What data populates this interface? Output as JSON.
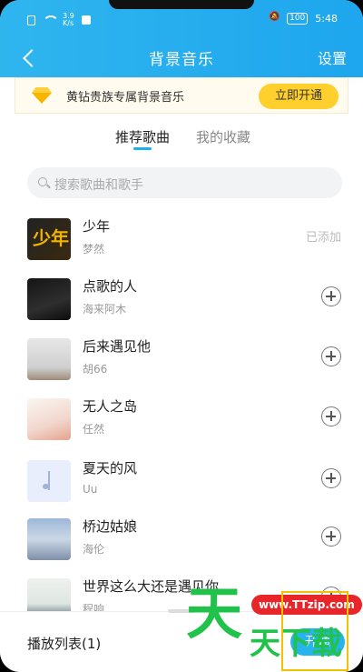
{
  "status": {
    "speed_top": "3.9",
    "speed_bottom": "K/s",
    "battery": "100",
    "time": "5:48"
  },
  "header": {
    "title": "背景音乐",
    "settings": "设置"
  },
  "vip": {
    "text": "黄钻贵族专属背景音乐",
    "button": "立即开通"
  },
  "tabs": [
    {
      "label": "推荐歌曲",
      "active": true
    },
    {
      "label": "我的收藏",
      "active": false
    }
  ],
  "search": {
    "placeholder": "搜索歌曲和歌手"
  },
  "songs": [
    {
      "title": "少年",
      "artist": "梦然",
      "status": "已添加"
    },
    {
      "title": "点歌的人",
      "artist": "海来阿木"
    },
    {
      "title": "后来遇见他",
      "artist": "胡66"
    },
    {
      "title": "无人之岛",
      "artist": "任然"
    },
    {
      "title": "夏天的风",
      "artist": "Uu"
    },
    {
      "title": "桥边姑娘",
      "artist": "海伦"
    },
    {
      "title": "世界这么大还是遇见你",
      "artist": "程响"
    }
  ],
  "cover_art": {
    "song_1": "少年"
  },
  "bottom": {
    "playlist": "播放列表(1)",
    "open_button": "开通"
  },
  "watermark": {
    "big": "天",
    "small": "天下载",
    "url": "www.TTzip.com"
  },
  "colors": {
    "accent": "#21b0ee",
    "vip_button": "#ffcf2e",
    "watermark_green": "#21c24a"
  }
}
